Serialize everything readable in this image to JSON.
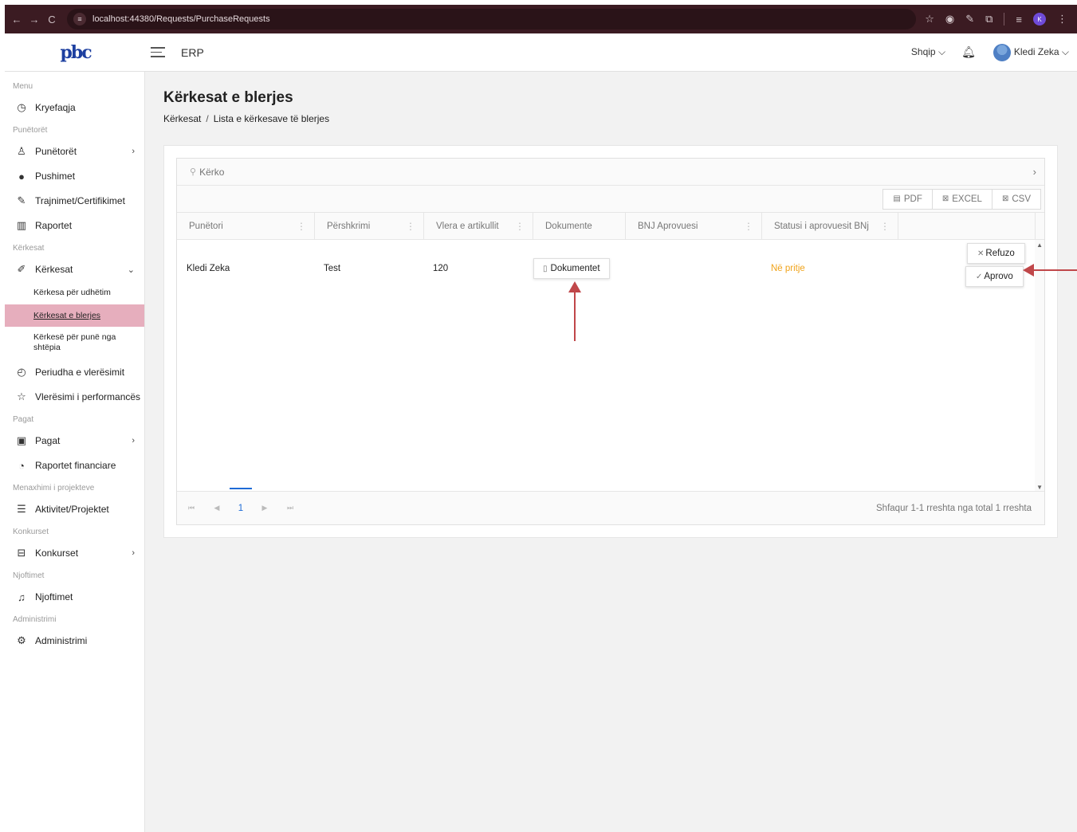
{
  "browser": {
    "back_icon": "←",
    "forward_icon": "→",
    "reload_icon": "C",
    "site_icon": "≡",
    "url": "localhost:44380/Requests/PurchaseRequests",
    "profile_initial": "K",
    "right_icons": [
      "☆",
      "◉",
      "✎",
      "⧉",
      "≡"
    ]
  },
  "header": {
    "logo_text": "pbc",
    "app_title": "ERP",
    "language": "Shqip",
    "user_name": "Kledi Zeka"
  },
  "sidebar": {
    "sections": {
      "menu": "Menu",
      "employees": "Punëtorët",
      "requests": "Kërkesat",
      "salaries": "Pagat",
      "projects": "Menaxhimi i projekteve",
      "competitions": "Konkurset",
      "notifications": "Njoftimet",
      "administration": "Administrimi"
    },
    "items": {
      "home": "Kryefaqja",
      "employees": "Punëtorët",
      "vacations": "Pushimet",
      "trainings": "Trajnimet/Certifikimet",
      "reports": "Raportet",
      "requests": "Kërkesat",
      "evaluation_period": "Periudha e vlerësimit",
      "performance": "Vlerësimi i performancës",
      "salaries": "Pagat",
      "financial_reports": "Raportet financiare",
      "activities": "Aktivitet/Projektet",
      "competitions": "Konkurset",
      "notifications": "Njoftimet",
      "administration": "Administrimi"
    },
    "sub_items": {
      "travel": "Kërkesa për udhëtim",
      "purchase": "Kërkesat e blerjes",
      "home_work": "Kërkesë për punë nga shtëpia"
    }
  },
  "page": {
    "title": "Kërkesat e blerjes",
    "breadcrumb_root": "Kërkesat",
    "breadcrumb_current": "Lista e kërkesave të blerjes"
  },
  "grid": {
    "search_placeholder": "Kërko",
    "export": {
      "pdf": "PDF",
      "excel": "EXCEL",
      "csv": "CSV"
    },
    "columns": {
      "employee": "Punëtori",
      "description": "Përshkrimi",
      "value": "Vlera e artikullit",
      "documents": "Dokumente",
      "approver": "BNJ Aprovuesi",
      "status": "Statusi i aprovuesit BNj"
    },
    "row": {
      "employee": "Kledi Zeka",
      "description": "Test",
      "value": "120",
      "documents_button": "Dokumentet",
      "approver": "",
      "status": "Në pritje",
      "reject": "Refuzo",
      "approve": "Aprovo"
    },
    "pager": {
      "current_page": "1",
      "info": "Shfaqur 1-1 rreshta nga total 1 rreshta"
    }
  }
}
